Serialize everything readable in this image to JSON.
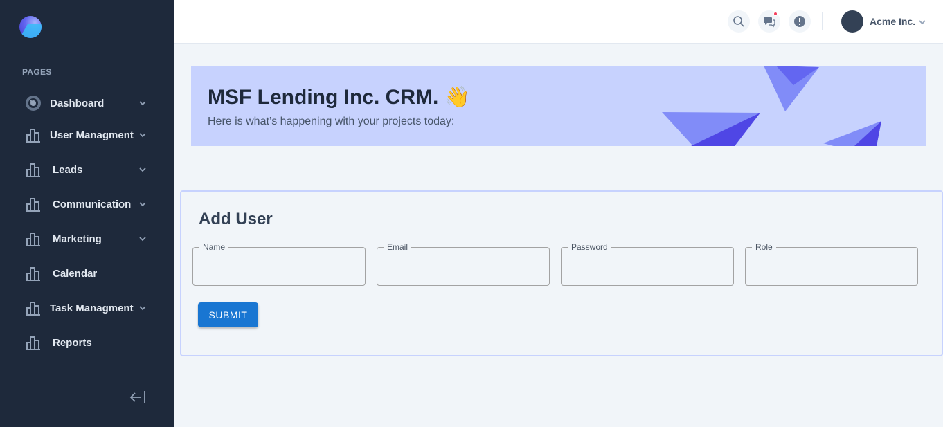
{
  "sidebar": {
    "section_label": "PAGES",
    "items": [
      {
        "label": "Dashboard",
        "icon": "dashboard-gauge-icon",
        "has_chevron": true
      },
      {
        "label": "User Managment",
        "icon": "bar-chart-icon",
        "has_chevron": true
      },
      {
        "label": "Leads",
        "icon": "bar-chart-icon",
        "has_chevron": true
      },
      {
        "label": "Communication",
        "icon": "bar-chart-icon",
        "has_chevron": true
      },
      {
        "label": "Marketing",
        "icon": "bar-chart-icon",
        "has_chevron": true
      },
      {
        "label": "Calendar",
        "icon": "bar-chart-icon",
        "has_chevron": false
      },
      {
        "label": "Task Managment",
        "icon": "bar-chart-icon",
        "has_chevron": true
      },
      {
        "label": "Reports",
        "icon": "bar-chart-icon",
        "has_chevron": false
      }
    ],
    "collapse_icon": "collapse-sidebar-icon"
  },
  "header": {
    "icons": [
      "search-icon",
      "chat-icon",
      "info-icon"
    ],
    "account_name": "Acme Inc."
  },
  "banner": {
    "title": "MSF Lending Inc. CRM. 👋",
    "subtitle": "Here is what’s happening with your projects today:"
  },
  "form": {
    "title": "Add User",
    "fields": [
      {
        "label": "Name",
        "value": ""
      },
      {
        "label": "Email",
        "value": ""
      },
      {
        "label": "Password",
        "value": ""
      },
      {
        "label": "Role",
        "value": ""
      }
    ],
    "submit_label": "SUBMIT"
  },
  "colors": {
    "sidebar_bg": "#1e293b",
    "banner_bg": "#c7d2fe",
    "accent": "#1976d2",
    "notification": "#f43f5e"
  }
}
